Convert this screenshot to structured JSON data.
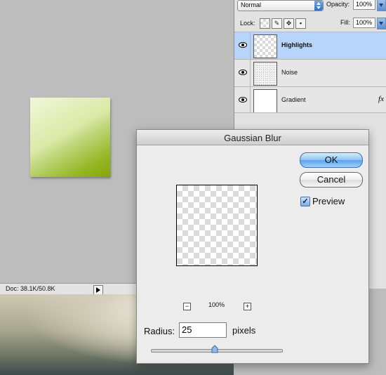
{
  "status_bar": {
    "doc_info": "Doc: 38.1K/50.8K"
  },
  "layers_panel": {
    "blend_mode": "Normal",
    "opacity_label": "Opacity:",
    "opacity_value": "100%",
    "lock_label": "Lock:",
    "fill_label": "Fill:",
    "fill_value": "100%",
    "layers": [
      {
        "name": "Highlights",
        "selected": true,
        "thumb": "transparent"
      },
      {
        "name": "Noise",
        "selected": false,
        "thumb": "noise"
      },
      {
        "name": "Gradient",
        "selected": false,
        "thumb": "white",
        "effects": "fx"
      }
    ]
  },
  "dialog": {
    "title": "Gaussian Blur",
    "ok_label": "OK",
    "cancel_label": "Cancel",
    "preview_label": "Preview",
    "preview_checked": true,
    "zoom": "100%",
    "radius_label": "Radius:",
    "radius_value": "25",
    "radius_units": "pixels",
    "radius_slider_fraction": 0.49
  },
  "colors": {
    "accent": "#5aa3ee",
    "selected_layer": "#b7d4fb",
    "thumbnail_light": "#f2f7da",
    "thumbnail_dark": "#83a60b"
  },
  "icons": {
    "visibility": "eye-icon",
    "lock_transparent": "lock-transparency-icon",
    "lock_image": "brush-icon",
    "lock_position": "move-icon",
    "lock_all": "lock-icon",
    "zoom_out": "minus-icon",
    "zoom_in": "plus-icon",
    "status_menu": "triangle-right-icon"
  }
}
